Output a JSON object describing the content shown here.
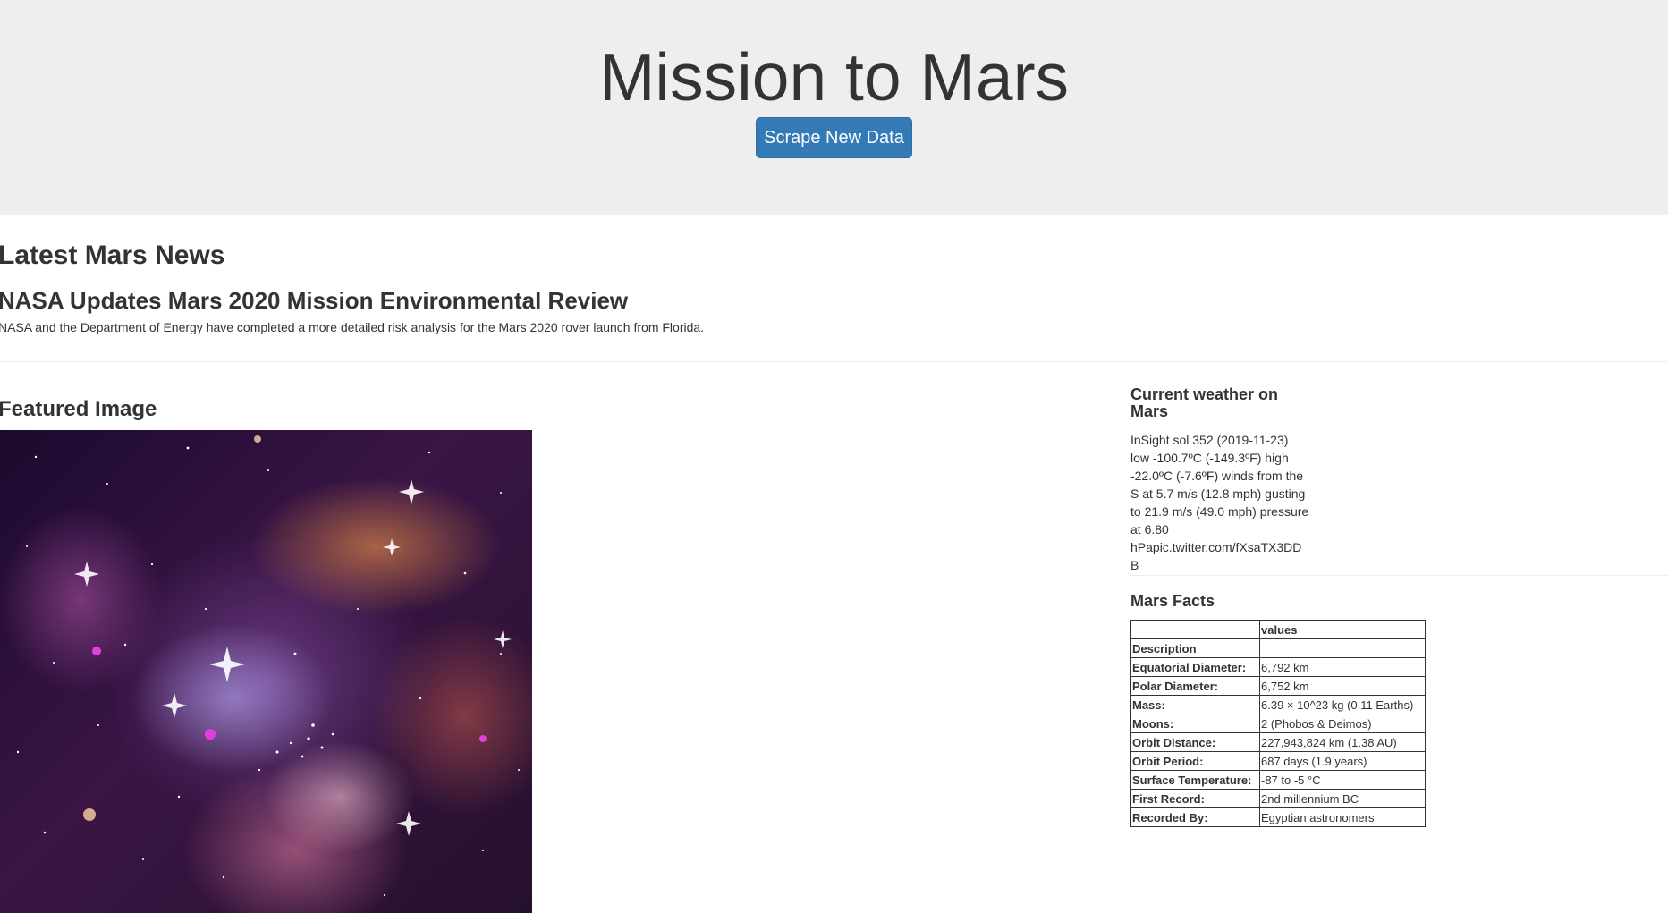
{
  "header": {
    "title": "Mission to Mars",
    "scrape_button_label": "Scrape New Data"
  },
  "news": {
    "section_heading": "Latest Mars News",
    "title": "NASA Updates Mars 2020 Mission Environmental Review",
    "teaser": "NASA and the Department of Energy have completed a more detailed risk analysis for the Mars 2020 rover launch from Florida."
  },
  "featured": {
    "heading": "Featured Image"
  },
  "weather": {
    "heading": "Current weather on Mars",
    "text": "InSight sol 352 (2019-11-23) low -100.7ºC (-149.3ºF) high -22.0ºC (-7.6ºF) winds from the S at 5.7 m/s (12.8 mph) gusting to 21.9 m/s (49.0 mph) pressure at 6.80 hPapic.twitter.com/fXsaTX3DDB"
  },
  "facts": {
    "heading": "Mars Facts",
    "column_header": "values",
    "index_label": "Description",
    "rows": [
      {
        "label": "Equatorial Diameter:",
        "value": "6,792 km"
      },
      {
        "label": "Polar Diameter:",
        "value": "6,752 km"
      },
      {
        "label": "Mass:",
        "value": "6.39 × 10^23 kg (0.11 Earths)"
      },
      {
        "label": "Moons:",
        "value": "2 (Phobos & Deimos)"
      },
      {
        "label": "Orbit Distance:",
        "value": "227,943,824 km (1.38 AU)"
      },
      {
        "label": "Orbit Period:",
        "value": "687 days (1.9 years)"
      },
      {
        "label": "Surface Temperature:",
        "value": "-87 to -5 °C"
      },
      {
        "label": "First Record:",
        "value": "2nd millennium BC"
      },
      {
        "label": "Recorded By:",
        "value": "Egyptian astronomers"
      }
    ]
  },
  "colors": {
    "jumbotron_bg": "#eeeeee",
    "button_primary": "#337ab7",
    "text": "#333333"
  }
}
